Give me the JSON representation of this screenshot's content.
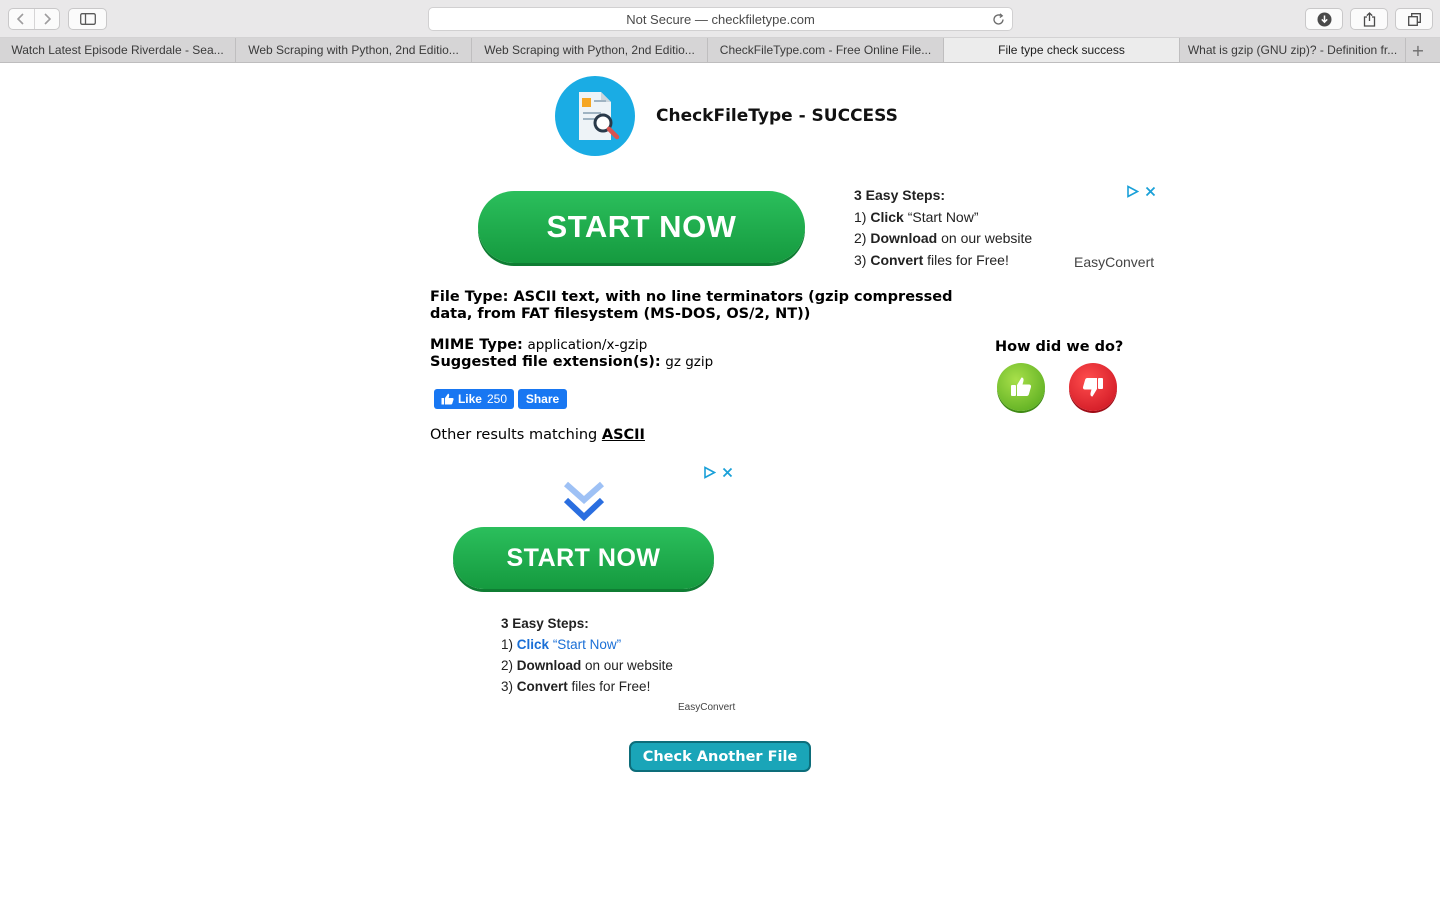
{
  "browser": {
    "address": "Not Secure — checkfiletype.com",
    "tabs": [
      {
        "label": "Watch Latest Episode Riverdale - Sea..."
      },
      {
        "label": "Web Scraping with Python, 2nd Editio..."
      },
      {
        "label": "Web Scraping with Python, 2nd Editio..."
      },
      {
        "label": "CheckFileType.com - Free Online File..."
      },
      {
        "label": "File type check success"
      },
      {
        "label": "What is gzip (GNU zip)? - Definition fr..."
      }
    ],
    "active_tab": 4
  },
  "header": {
    "title": "CheckFileType - SUCCESS"
  },
  "ad_top": {
    "button": "START NOW",
    "steps_title": "3 Easy Steps:",
    "steps": [
      {
        "num": "1)",
        "bold": "Click",
        "rest": " “Start Now”"
      },
      {
        "num": "2)",
        "bold": "Download",
        "rest": " on our website"
      },
      {
        "num": "3)",
        "bold": "Convert",
        "rest": " files for Free!"
      }
    ],
    "brand": "EasyConvert"
  },
  "result": {
    "file_type_label": "File Type:",
    "file_type_line1": "ASCII text, with no line terminators (gzip compressed",
    "file_type_line2": "data, from FAT filesystem (MS-DOS, OS/2, NT))",
    "mime_label": "MIME Type:",
    "mime_value": "application/x-gzip",
    "ext_label": "Suggested file extension(s):",
    "ext_value": "gz gzip",
    "other_prefix": "Other results matching ",
    "other_link": "ASCII"
  },
  "social": {
    "like_label": "Like",
    "like_count": "250",
    "share_label": "Share"
  },
  "feedback": {
    "title": "How did we do?"
  },
  "ad_bottom": {
    "button": "START NOW",
    "steps_title": "3 Easy Steps:",
    "steps": [
      {
        "num": "1)",
        "bold": "Click",
        "rest": " “Start Now”"
      },
      {
        "num": "2)",
        "bold": "Download",
        "rest": " on our website"
      },
      {
        "num": "3)",
        "bold": "Convert",
        "rest": " files for Free!"
      }
    ],
    "brand": "EasyConvert"
  },
  "actions": {
    "check_another": "Check Another File"
  }
}
